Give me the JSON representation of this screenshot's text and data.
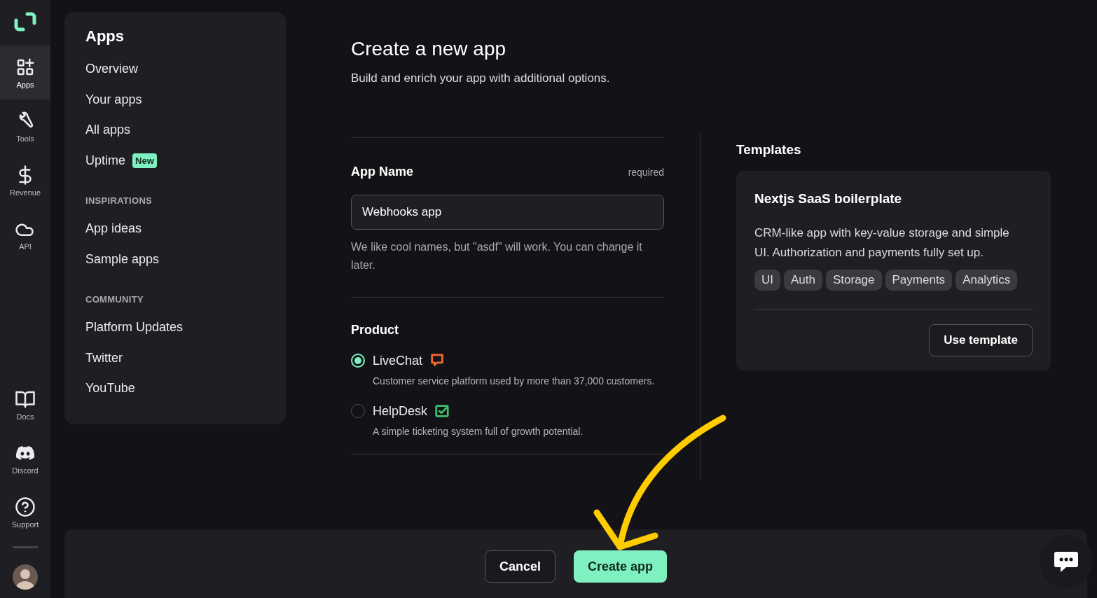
{
  "rail": {
    "top_items": [
      {
        "label": "Apps",
        "kind": "apps",
        "selected": true
      },
      {
        "label": "Tools",
        "kind": "tools",
        "selected": false
      },
      {
        "label": "Revenue",
        "kind": "revenue",
        "selected": false
      },
      {
        "label": "API",
        "kind": "api",
        "selected": false
      }
    ],
    "bottom_items": [
      {
        "label": "Docs",
        "kind": "docs",
        "selected": false
      },
      {
        "label": "Discord",
        "kind": "discord",
        "selected": false
      },
      {
        "label": "Support",
        "kind": "support",
        "selected": false
      }
    ]
  },
  "nav": {
    "title": "Apps",
    "sections": [
      {
        "items": [
          {
            "label": "Overview"
          },
          {
            "label": "Your apps"
          },
          {
            "label": "All apps"
          },
          {
            "label": "Uptime",
            "badge": "New"
          }
        ]
      },
      {
        "heading": "INSPIRATIONS",
        "items": [
          {
            "label": "App ideas"
          },
          {
            "label": "Sample apps"
          }
        ]
      },
      {
        "heading": "COMMUNITY",
        "items": [
          {
            "label": "Platform Updates"
          },
          {
            "label": "Twitter"
          },
          {
            "label": "YouTube"
          }
        ]
      }
    ]
  },
  "form": {
    "title": "Create a new app",
    "subtitle": "Build and enrich your app with additional options.",
    "app_name": {
      "label": "App Name",
      "required_note": "required",
      "value": "Webhooks app",
      "hint": "We like cool names, but \"asdf\" will work. You can change it later."
    },
    "product": {
      "label": "Product",
      "options": [
        {
          "name": "LiveChat",
          "kind": "chat",
          "selected": true,
          "description": "Customer service platform used by more than 37,000 customers."
        },
        {
          "name": "HelpDesk",
          "kind": "ticket",
          "selected": false,
          "description": "A simple ticketing system full of growth potential."
        }
      ]
    }
  },
  "templates": {
    "heading": "Templates",
    "cards": [
      {
        "title": "Nextjs SaaS boilerplate",
        "description": "CRM-like app with key-value storage and simple UI. Authorization and payments fully set up.",
        "tags": [
          "UI",
          "Auth",
          "Storage",
          "Payments",
          "Analytics"
        ],
        "button": "Use template"
      }
    ]
  },
  "footer": {
    "cancel": "Cancel",
    "create": "Create app"
  }
}
